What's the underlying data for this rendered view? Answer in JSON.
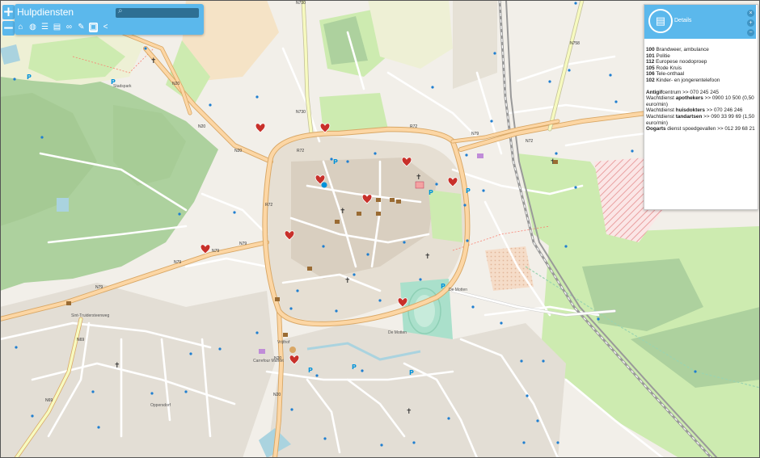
{
  "app": {
    "title": "Hulpdiensten"
  },
  "toolbar": {
    "zoom_in": "+",
    "zoom_out": "−",
    "tools": [
      {
        "name": "home-icon",
        "glyph": "⌂"
      },
      {
        "name": "globe-icon",
        "glyph": "◍"
      },
      {
        "name": "layers-icon",
        "glyph": "☰"
      },
      {
        "name": "print-icon",
        "glyph": "▤"
      },
      {
        "name": "binoculars-icon",
        "glyph": "∞"
      },
      {
        "name": "pencil-icon",
        "glyph": "✎"
      },
      {
        "name": "chat-icon",
        "glyph": "▣"
      },
      {
        "name": "share-icon",
        "glyph": "<"
      }
    ]
  },
  "details": {
    "title": "Details",
    "lines": [
      {
        "b": "100",
        "t": " Brandweer, ambulance"
      },
      {
        "b": "101",
        "t": " Politie"
      },
      {
        "b": "112",
        "t": " Europese noodoproep"
      },
      {
        "b": "105",
        "t": " Rode Kruis"
      },
      {
        "b": "106",
        "t": " Tele-onthaal"
      },
      {
        "b": "102",
        "t": " Kinder- en jongerentelefoon"
      }
    ],
    "lines2": [
      {
        "b": "Antigif",
        "t": "centrum >> 070 245 245"
      },
      {
        "pre": "Wachtdienst ",
        "b": "apothekers",
        "t": " >> 0900 10 500 (0,50"
      },
      {
        "t": "euro/min)"
      },
      {
        "pre": "Wachtdienst ",
        "b": "huisdokters",
        "t": " >> 070 246 246"
      },
      {
        "pre": "Wachtdienst ",
        "b": "tandartsen",
        "t": " >> 090 33 99 69 (1,50"
      },
      {
        "t": "euro/min)"
      },
      {
        "b": "Oogarts",
        "t": " dienst spoedgevallen >> 012 39 68 21"
      }
    ]
  },
  "map": {
    "road_labels": [
      "N20",
      "N20",
      "N20",
      "N20",
      "N20",
      "N79",
      "N79",
      "N79",
      "N79",
      "N79",
      "N72",
      "N72",
      "R72",
      "R72",
      "R72",
      "N730",
      "N730",
      "N758",
      "N69",
      "N69"
    ],
    "place_labels": [
      "De Motten",
      "Carrefour Market",
      "Vrijthof",
      "Sint-Truidersteenweg",
      "Stadspark",
      "Oppersdorf",
      "De Motten"
    ]
  }
}
